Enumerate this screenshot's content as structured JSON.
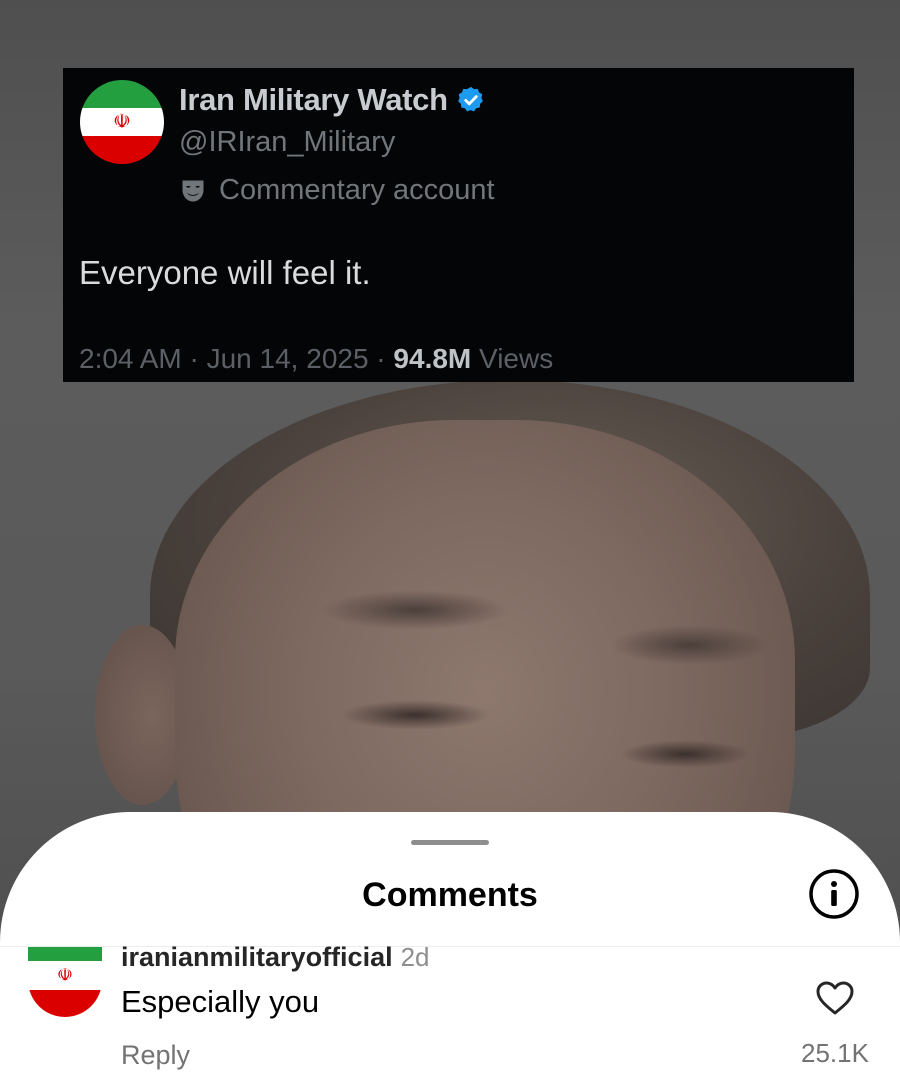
{
  "tweet": {
    "display_name": "Iran Military Watch",
    "handle": "@IRIran_Military",
    "account_label": "Commentary account",
    "text": "Everyone will feel it.",
    "timestamp": "2:04 AM · Jun 14, 2025 · ",
    "views_count": "94.8M",
    "views_label": " Views",
    "avatar_emblem": "☫",
    "verified_color": "#1d9bf0"
  },
  "comments_sheet": {
    "title": "Comments",
    "comments": [
      {
        "author": "iranianmilitaryofficial",
        "time": "2d",
        "text": "Especially you",
        "reply_label": "Reply",
        "like_count": "25.1K",
        "avatar_emblem": "☫"
      }
    ]
  },
  "colors": {
    "flag_green": "#239f40",
    "flag_red": "#da0000",
    "sheet_bg": "#ffffff",
    "tweet_bg": "#040506"
  }
}
